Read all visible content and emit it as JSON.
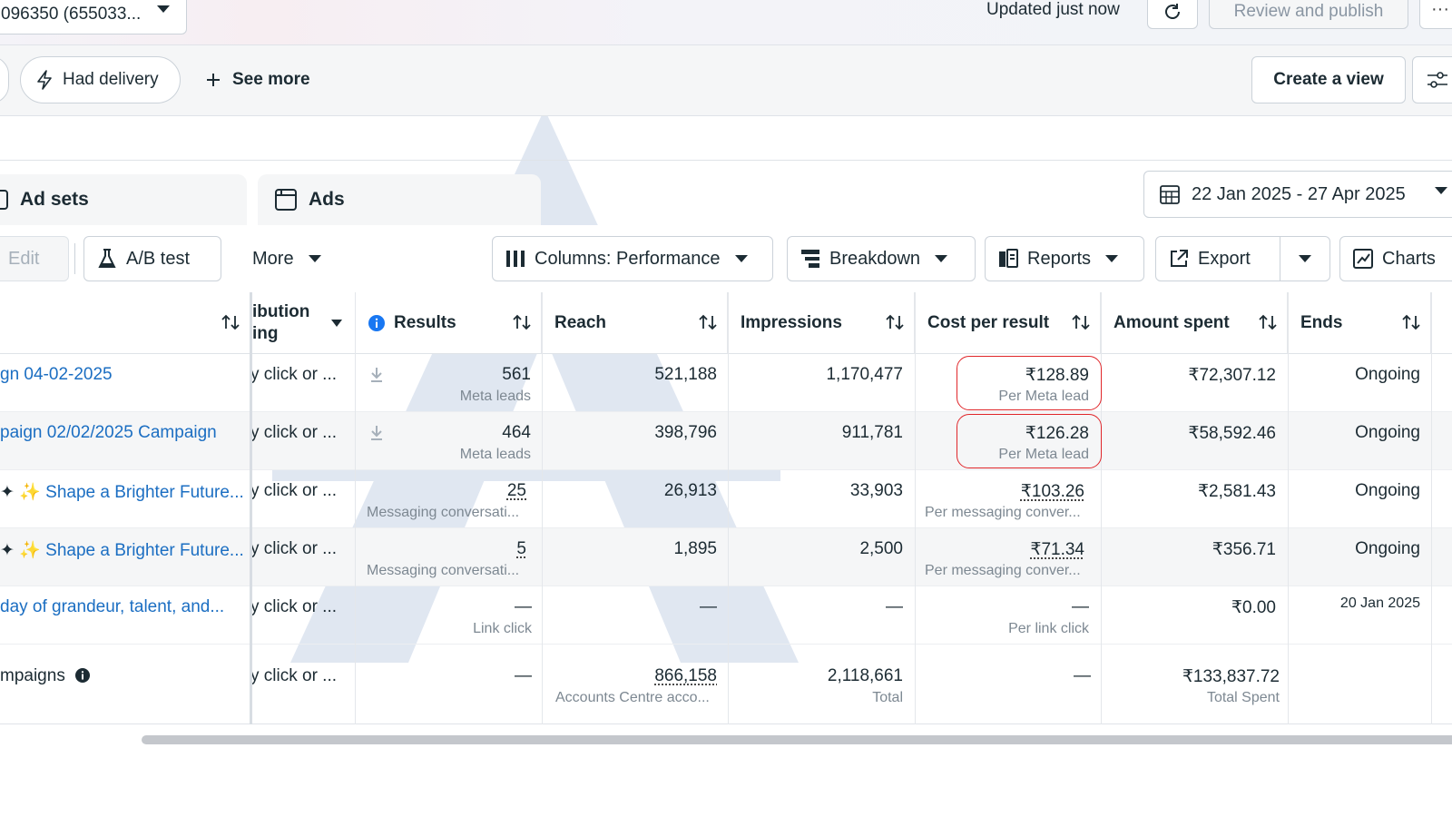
{
  "topbar": {
    "account_select": "096350 (655033...",
    "updated_text": "Updated just now",
    "review_publish": "Review and publish",
    "more_glyph": "···"
  },
  "filters": {
    "had_delivery": "Had delivery",
    "see_more": "See more",
    "create_view": "Create a view"
  },
  "tabs": [
    {
      "label": "Ad sets"
    },
    {
      "label": "Ads"
    }
  ],
  "date_range": "22 Jan 2025 - 27 Apr 2025",
  "toolbar": {
    "edit": "Edit",
    "ab_test": "A/B test",
    "more": "More",
    "columns": "Columns: Performance",
    "breakdown": "Breakdown",
    "reports": "Reports",
    "export": "Export",
    "charts": "Charts"
  },
  "columns": {
    "attribution_line1": "ibution",
    "attribution_line2": "ing",
    "results": "Results",
    "reach": "Reach",
    "impressions": "Impressions",
    "cost_per_result": "Cost per result",
    "amount_spent": "Amount spent",
    "ends": "Ends"
  },
  "rows": [
    {
      "name": "gn 04-02-2025",
      "attribution": "y click or ...",
      "results": "561",
      "results_sub": "Meta leads",
      "reach": "521,188",
      "impressions": "1,170,477",
      "cpr": "₹128.89",
      "cpr_sub": "Per Meta lead",
      "spent": "₹72,307.12",
      "ends": "Ongoing"
    },
    {
      "name": "paign 02/02/2025 Campaign",
      "attribution": "y click or ...",
      "results": "464",
      "results_sub": "Meta leads",
      "reach": "398,796",
      "impressions": "911,781",
      "cpr": "₹126.28",
      "cpr_sub": "Per Meta lead",
      "spent": "₹58,592.46",
      "ends": "Ongoing"
    },
    {
      "name": "Shape a Brighter Future...",
      "attribution": "y click or ...",
      "results": "25",
      "results_sub": "Messaging conversati...",
      "reach": "26,913",
      "impressions": "33,903",
      "cpr": "₹103.26",
      "cpr_sub": "Per messaging conver...",
      "spent": "₹2,581.43",
      "ends": "Ongoing"
    },
    {
      "name": "Shape a Brighter Future...",
      "attribution": "y click or ...",
      "results": "5",
      "results_sub": "Messaging conversati...",
      "reach": "1,895",
      "impressions": "2,500",
      "cpr": "₹71.34",
      "cpr_sub": "Per messaging conver...",
      "spent": "₹356.71",
      "ends": "Ongoing"
    },
    {
      "name": "day of grandeur, talent, and...",
      "attribution": "y click or ...",
      "results": "—",
      "results_sub": "Link click",
      "reach": "—",
      "impressions": "—",
      "cpr": "—",
      "cpr_sub": "Per link click",
      "spent": "₹0.00",
      "ends": "20 Jan 2025"
    }
  ],
  "totals": {
    "name": "mpaigns",
    "attribution": "y click or ...",
    "results": "—",
    "reach": "866,158",
    "reach_sub": "Accounts Centre acco...",
    "impressions": "2,118,661",
    "impressions_sub": "Total",
    "cpr": "—",
    "spent": "₹133,837.72",
    "spent_sub": "Total Spent"
  },
  "colors": {
    "link": "#1b6ec2",
    "highlight": "#e0262a",
    "info": "#1877f2"
  }
}
